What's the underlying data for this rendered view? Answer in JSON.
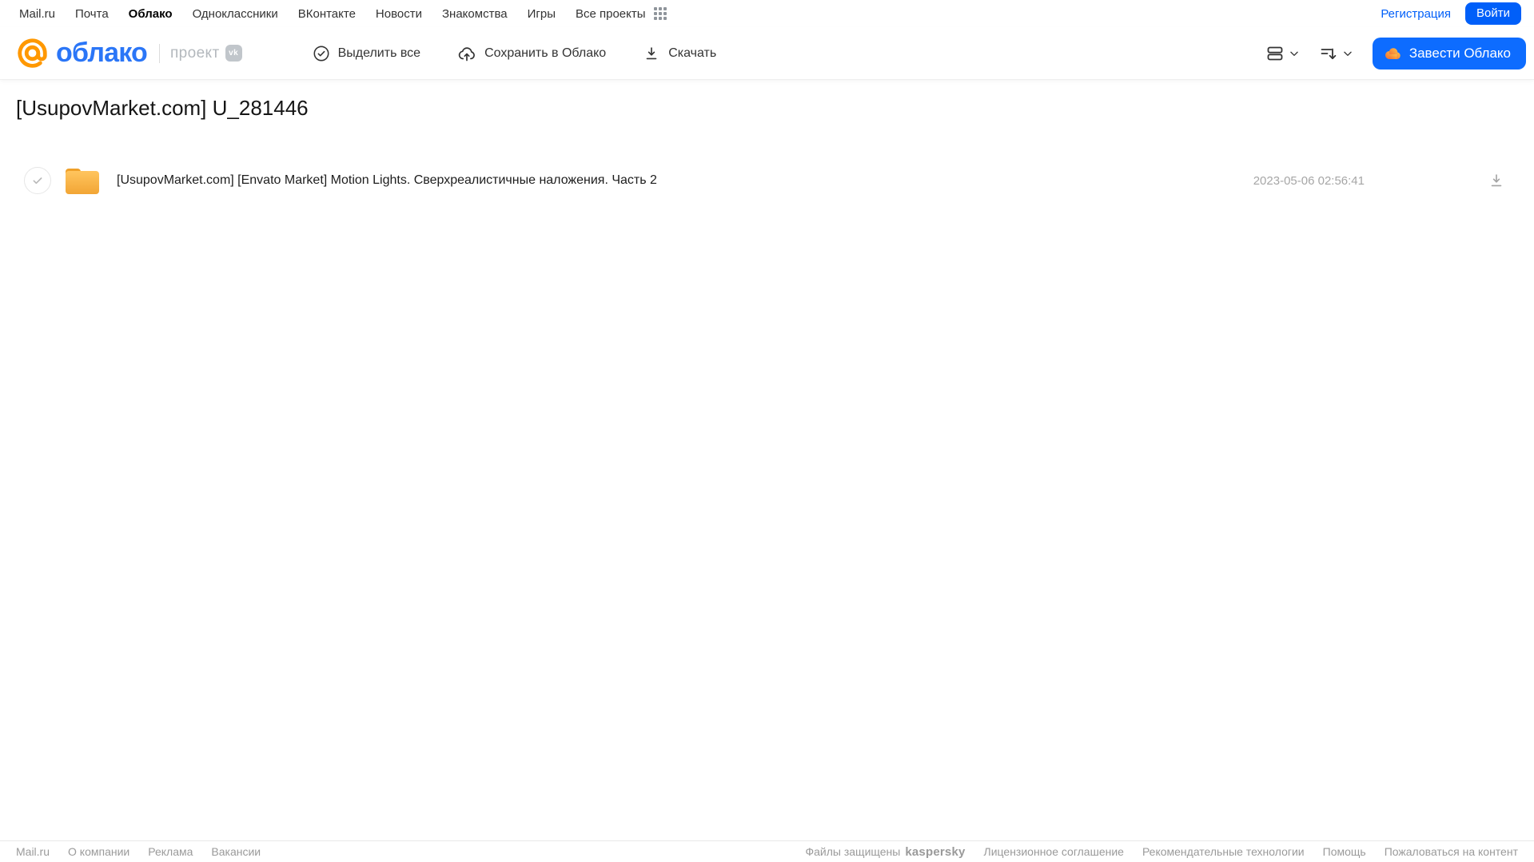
{
  "topnav": {
    "items": [
      "Mail.ru",
      "Почта",
      "Облако",
      "Одноклассники",
      "ВКонтакте",
      "Новости",
      "Знакомства",
      "Игры",
      "Все проекты"
    ],
    "active_item": "Облако",
    "registration_label": "Регистрация",
    "login_label": "Войти"
  },
  "header": {
    "logo_text": "облако",
    "project_label": "проект",
    "vk_badge_label": "vk",
    "select_all_label": "Выделить все",
    "save_to_cloud_label": "Сохранить в Облако",
    "download_label": "Скачать",
    "get_cloud_label": "Завести Облако"
  },
  "main": {
    "title": "[UsupovMarket.com] U_281446",
    "file": {
      "type": "folder",
      "name": "[UsupovMarket.com] [Envato Market] Motion Lights. Сверхреалистичные наложения. Часть 2",
      "date": "2023-05-06 02:56:41"
    }
  },
  "footer": {
    "links_left": [
      "Mail.ru",
      "О компании",
      "Реклама",
      "Вакансии"
    ],
    "protected_label": "Файлы защищены",
    "kaspersky_label": "kaspersky",
    "links_right": [
      "Лицензионное соглашение",
      "Рекомендательные технологии",
      "Помощь",
      "Пожаловаться на контент"
    ]
  },
  "colors": {
    "accent_blue": "#005ff9",
    "primary_button_blue": "#0d6cff",
    "logo_orange": "#ff9800",
    "logo_blue": "#2b76f7",
    "folder_yellow": "#f5a93b",
    "kaspersky_green": "#00a88e",
    "muted_text": "#9a9a9a"
  }
}
